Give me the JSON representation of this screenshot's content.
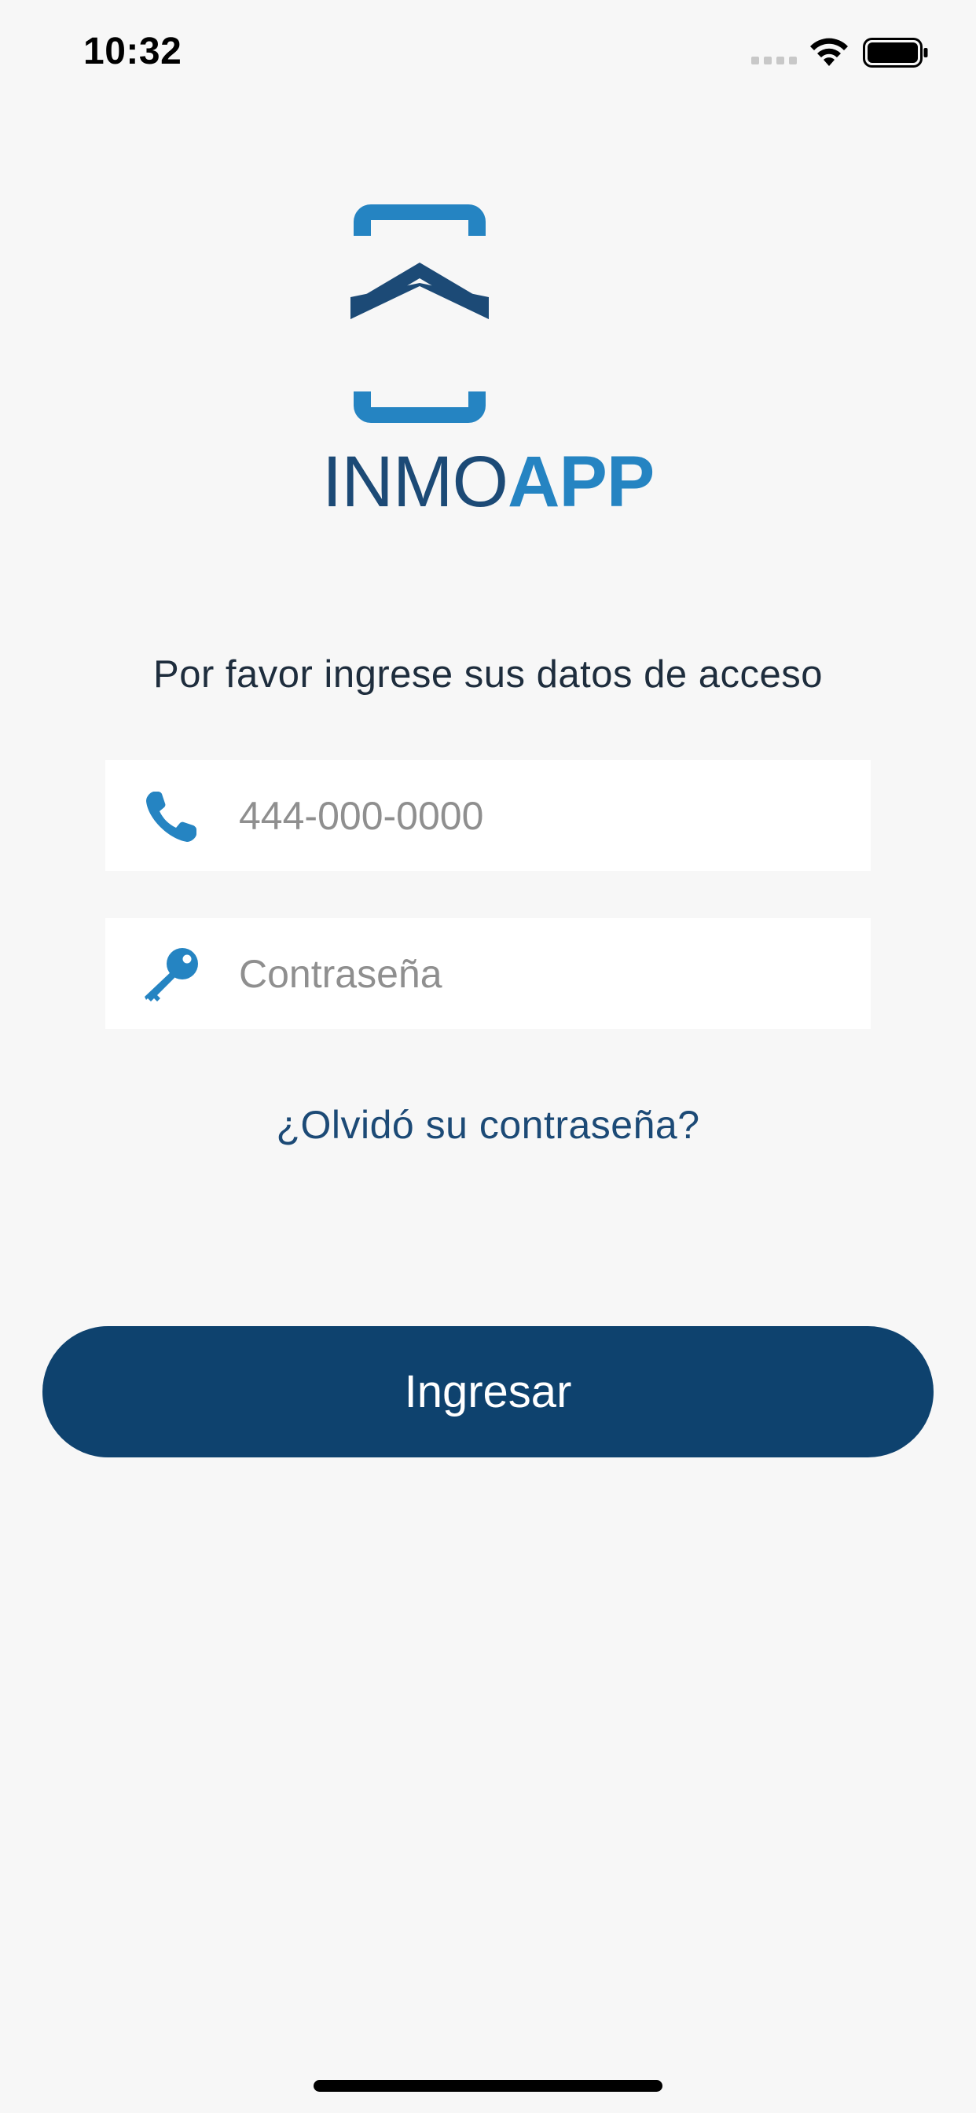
{
  "status_bar": {
    "time": "10:32"
  },
  "logo": {
    "text_light": "INMO",
    "text_bold": "APP",
    "colors": {
      "light": "#1c4a76",
      "bold": "#2584c2"
    }
  },
  "login": {
    "prompt": "Por favor ingrese sus datos de acceso",
    "phone": {
      "placeholder": "444-000-0000",
      "value": "",
      "icon": "phone-icon"
    },
    "password": {
      "placeholder": "Contraseña",
      "value": "",
      "icon": "key-icon"
    },
    "forgot_label": "¿Olvidó su contraseña?",
    "submit_label": "Ingresar"
  },
  "colors": {
    "background": "#f7f7f7",
    "primary": "#0e426e",
    "accent": "#2584c2"
  }
}
